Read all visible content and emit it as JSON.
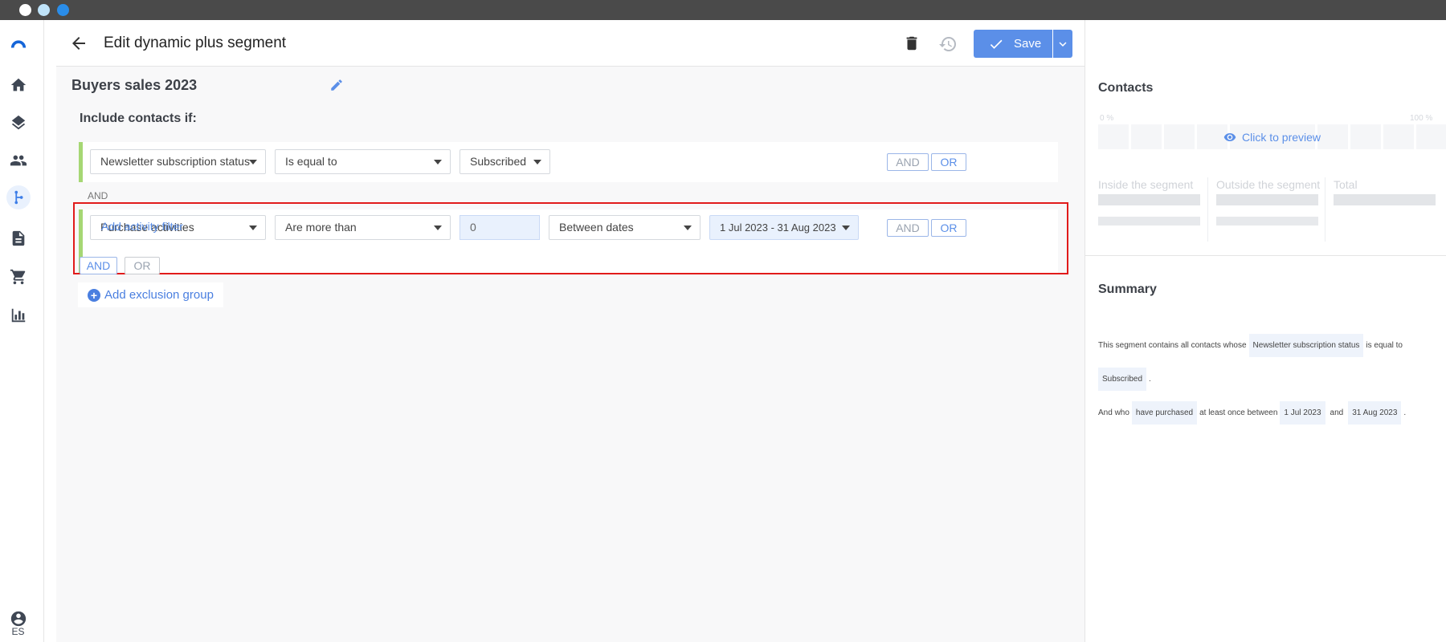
{
  "window": {
    "traffic_lights": [
      "#ffffff",
      "#bfe3f9",
      "#2a8de9"
    ]
  },
  "rail": {
    "items": [
      "logo-icon",
      "home-icon",
      "layers-icon",
      "contacts-icon",
      "segments-icon",
      "document-icon",
      "cart-icon",
      "chart-icon"
    ],
    "active": "segments-icon",
    "language": "ES"
  },
  "header": {
    "title": "Edit dynamic plus segment",
    "save_label": "Save"
  },
  "segment": {
    "name": "Buyers sales 2023",
    "include_label": "Include contacts if:"
  },
  "condition1": {
    "field": "Newsletter subscription status",
    "operator": "Is equal to",
    "value": "Subscribed",
    "and_label": "AND",
    "or_label": "OR"
  },
  "separator": "AND",
  "condition2": {
    "field": "Purchase activities",
    "operator": "Are more than",
    "count": "0",
    "period": "Between dates",
    "date_range": "1 Jul 2023 - 31 Aug 2023",
    "add_filter": "Add activity filter",
    "and_label": "AND",
    "or_label": "OR"
  },
  "group_logic": {
    "and_label": "AND",
    "or_label": "OR"
  },
  "add_exclusion": "Add exclusion group",
  "contacts": {
    "title": "Contacts",
    "pct_min": "0 %",
    "pct_max": "100 %",
    "preview": "Click to preview",
    "inside_label": "Inside the segment",
    "outside_label": "Outside the segment",
    "total_label": "Total"
  },
  "summary": {
    "title": "Summary",
    "line1_prefix": "This segment contains all contacts whose",
    "field_chip": "Newsletter subscription status",
    "operator_text": "is equal to",
    "value_chip": "Subscribed",
    "period": ".",
    "line2_prefix": "And who",
    "action_chip": "have purchased",
    "between_text": "at least once between",
    "start_chip": "1 Jul 2023",
    "and_text": "and",
    "end_chip": "31 Aug 2023",
    "end_period": "."
  },
  "colors": {
    "accent": "#5b8fe8",
    "condition_bar": "#a6d774",
    "highlight": "#e11b1b"
  }
}
